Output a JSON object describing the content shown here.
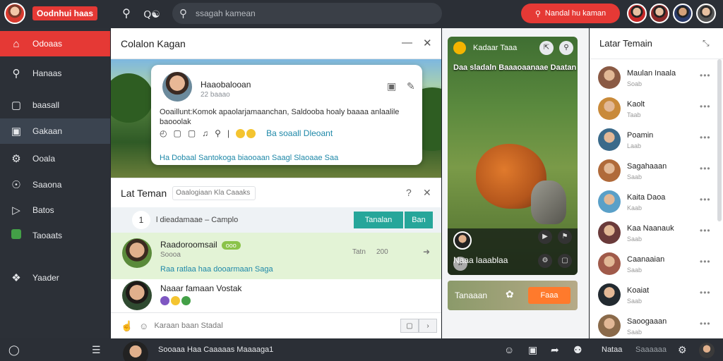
{
  "app": {
    "brand": "Oodnhui haas"
  },
  "topbar": {
    "search_placeholder": "ssagah kamean",
    "live_label": "Nandal hu kaman",
    "icon_search": "search-icon",
    "icon_people": "people-icon"
  },
  "sidebar": {
    "items": [
      {
        "label": "Odoaas",
        "icon": "home-icon"
      },
      {
        "label": "Hanaas",
        "icon": "search-icon"
      },
      {
        "label": "baasall",
        "icon": "chat-icon"
      },
      {
        "label": "Gakaan",
        "icon": "folder-icon"
      },
      {
        "label": "Ooala",
        "icon": "gear-icon"
      },
      {
        "label": "Saaona",
        "icon": "compass-icon"
      },
      {
        "label": "Batos",
        "icon": "video-icon"
      },
      {
        "label": "Taoaats",
        "icon": "green-box-icon"
      },
      {
        "label": "Yaader",
        "icon": "shield-icon"
      }
    ]
  },
  "chat": {
    "title": "Colalon Kagan",
    "post": {
      "author": "Haaobalooan",
      "time": "22 baaao",
      "body": "Ooaillunt:Komok apaolarjamaanchan, Saldooba hoaly baaaa anlaalile baooolak",
      "link_text": "Ba soaall Dleoant",
      "tags": "Ha Dobaal Santokoga biaooaan Saagl Slaoaae Saa"
    }
  },
  "friends_panel": {
    "title": "Lat Teman",
    "filter_placeholder": "Oaalogiaan Kla Caaaks",
    "filter_count": "1",
    "filter_label": "l dieadamaae – Camplo",
    "teman_btn": "Tanalan",
    "ban_btn": "Ban",
    "rows": [
      {
        "name": "Raadoroomsail",
        "pill": "ooo",
        "sub": "Soooa",
        "time": "Tatn",
        "count": "200",
        "msg": "Raa ratlaa haa dooarmaan Saga"
      },
      {
        "name": "Naaar famaan Vostak",
        "sub": ""
      }
    ],
    "composer_placeholder": "Karaan baan Stadal"
  },
  "game": {
    "header": "Kadaar Taaa",
    "title": "Daa sladaln Baaaoaanaae Daatan",
    "player": "Naaa laaablaa",
    "footer": "Tanaaan",
    "footer_btn": "Faaa"
  },
  "right_panel": {
    "title": "Latar Temain",
    "friends": [
      {
        "name": "Maulan Inaala",
        "sub": "Soab",
        "color": "#8a5a44"
      },
      {
        "name": "Kaolt",
        "sub": "Taab",
        "color": "#c98a3a"
      },
      {
        "name": "Poamin",
        "sub": "Laab",
        "color": "#3a6a8a"
      },
      {
        "name": "Sagahaaan",
        "sub": "Saab",
        "color": "#b06a3a"
      },
      {
        "name": "Kaita Daoa",
        "sub": "Kaab",
        "color": "#5aa0c8"
      },
      {
        "name": "Kaa Naanauk",
        "sub": "Saab",
        "color": "#6a3a3a"
      },
      {
        "name": "Caanaaian",
        "sub": "Saab",
        "color": "#a05a4a"
      },
      {
        "name": "Koaiat",
        "sub": "Saab",
        "color": "#222a30"
      },
      {
        "name": "Saoogaaan",
        "sub": "Saab",
        "color": "#8a6a4a"
      }
    ]
  },
  "bottom": {
    "chat_text": "Sooaaa Haa Caaaaas Maaaaga1",
    "menu1": "Nataa",
    "menu2": "Saaaaaa"
  },
  "colors": {
    "accent": "#e53935",
    "teal": "#26a69a",
    "orange": "#ff7a2c"
  }
}
